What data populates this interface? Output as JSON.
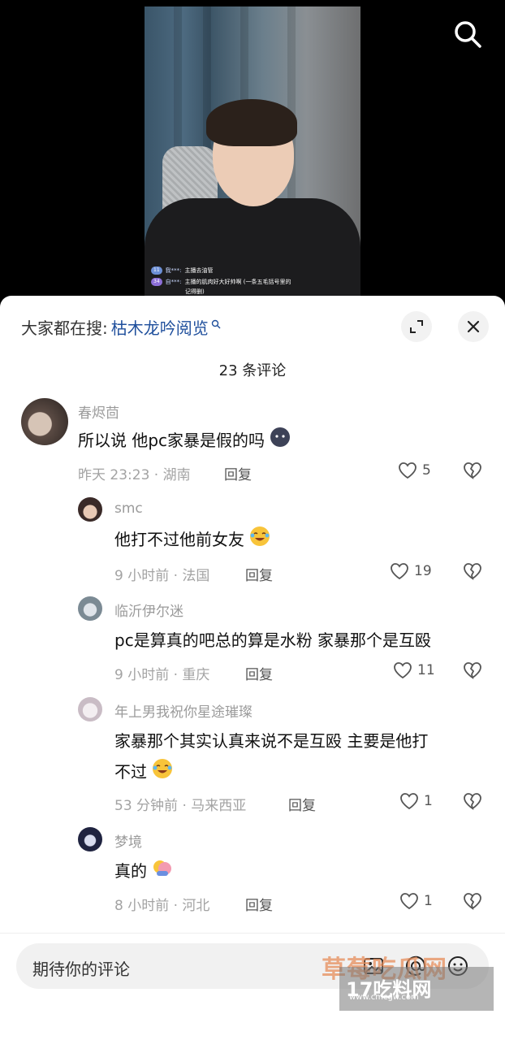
{
  "danmaku": [
    {
      "level": "11",
      "user": "我***:",
      "text": "主播去油管"
    },
    {
      "level": "34",
      "user": "自***:",
      "text": "主播的肌肉好大好帅啊 (一条五毛括号里的"
    },
    {
      "level": "",
      "user": "",
      "text": "记得删)"
    }
  ],
  "search_bar": {
    "prefix": "大家都在搜:",
    "keyword": "枯木龙吟阅览"
  },
  "sheet_title": "23 条评论",
  "comments": [
    {
      "name": "春烬茴",
      "text": "所以说 他pc家暴是假的吗",
      "meta": "昨天 23:23 · 湖南",
      "reply": "回复",
      "likes": "5"
    },
    {
      "name": "smc",
      "text": "他打不过他前女友",
      "meta": "9 小时前 · 法国",
      "reply": "回复",
      "likes": "19"
    },
    {
      "name": "临沂伊尔迷",
      "text": "pc是算真的吧总的算是水粉 家暴那个是互殴",
      "meta": "9 小时前 · 重庆",
      "reply": "回复",
      "likes": "11"
    },
    {
      "name": "年上男我祝你星途璀璨",
      "text_line1": "家暴那个其实认真来说不是互殴 主要是他打",
      "text_line2": "不过",
      "meta": "53 分钟前 · 马来西亚",
      "reply": "回复",
      "likes": "1"
    },
    {
      "name": "梦境",
      "text": "真的",
      "meta": "8 小时前 · 河北",
      "reply": "回复",
      "likes": "1"
    }
  ],
  "input": {
    "placeholder": "期待你的评论"
  },
  "watermark": {
    "title": "草莓吃瓜网",
    "sub": "17吃料网",
    "url": "www.cmcgw.com"
  },
  "colors": {
    "keyword": "#1f4f9c",
    "meta": "#a3a3a3",
    "sheet_bg": "#ffffff"
  }
}
